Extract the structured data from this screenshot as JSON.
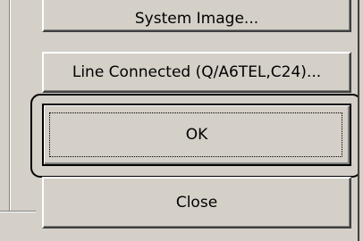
{
  "buttons": {
    "system_image": "System Image...",
    "line_connected": "Line Connected (Q/A6TEL,C24)...",
    "ok": "OK",
    "close": "Close"
  }
}
